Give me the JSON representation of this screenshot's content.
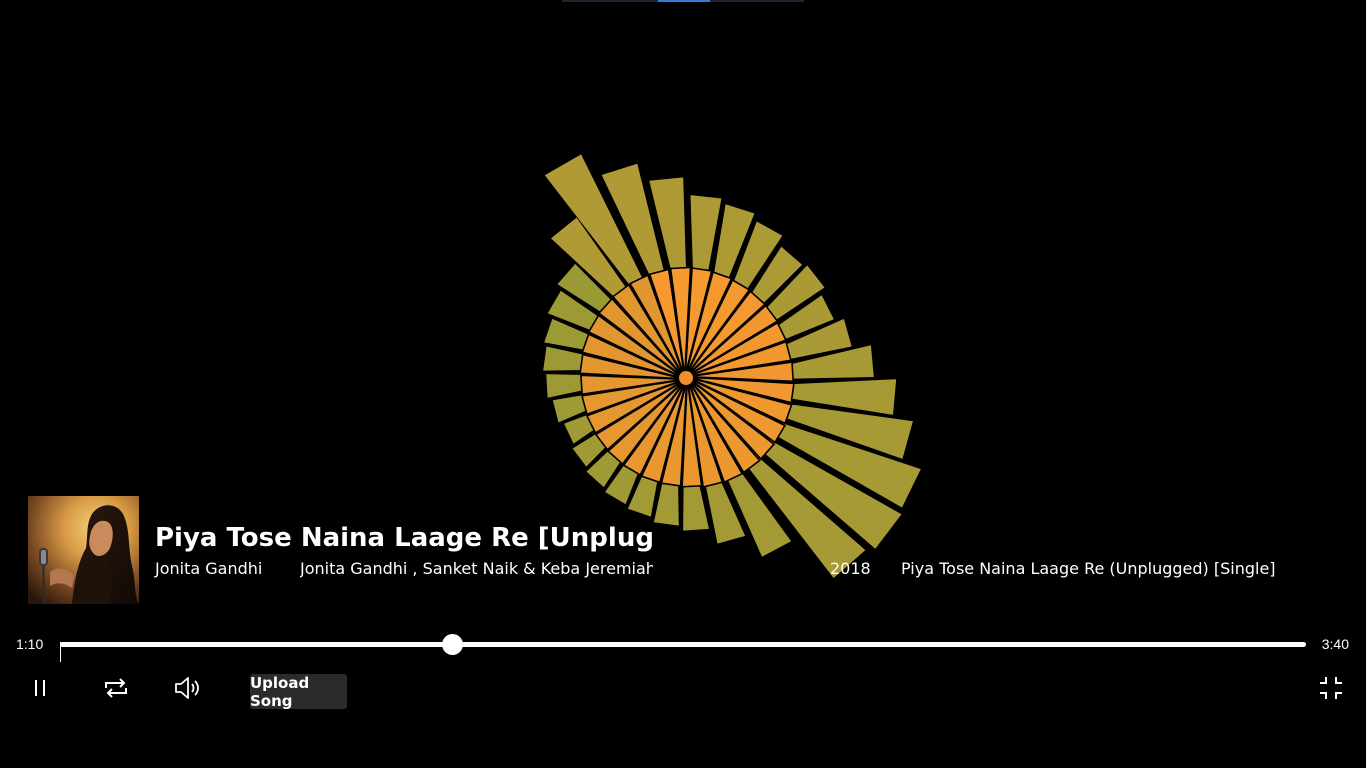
{
  "now_playing": {
    "title": "Piya Tose Naina Laage Re [Unplugged]",
    "artist": "Jonita Gandhi",
    "credits": "Jonita Gandhi , Sanket Naik & Keba Jeremiah",
    "year": "2018",
    "album": "Piya Tose Naina Laage Re (Unplugged) [Single]"
  },
  "playback": {
    "current_time": "1:10",
    "total_time": "3:40",
    "progress": 0.315,
    "state": "playing"
  },
  "controls": {
    "pause_icon": "pause-icon",
    "repeat_icon": "repeat-icon",
    "volume_icon": "volume-icon",
    "fullscreen_exit_icon": "exit-fullscreen-icon",
    "upload_label": "Upload Song"
  },
  "visualizer": {
    "type": "radial-spiral-bars",
    "bar_count": 32,
    "inner_colors": [
      "#f7992f",
      "#e09630"
    ],
    "outer_colors": [
      "#b09a35",
      "#9a9a35"
    ],
    "outer_levels": [
      0.62,
      0.95,
      0.78,
      0.66,
      0.55,
      0.52,
      0.48,
      0.42,
      0.44,
      0.4,
      0.46,
      0.58,
      0.72,
      0.85,
      0.98,
      1.0,
      0.96,
      0.62,
      0.46,
      0.36,
      0.33,
      0.3,
      0.28,
      0.26,
      0.24,
      0.22,
      0.25,
      0.28,
      0.3,
      0.32,
      0.36,
      0.4
    ],
    "inner_levels": [
      0.95,
      0.98,
      0.96,
      0.92,
      0.88,
      0.86,
      0.84,
      0.8,
      0.78,
      0.82,
      0.86,
      0.9,
      0.94,
      0.96,
      0.98,
      1.0,
      0.97,
      0.9,
      0.86,
      0.84,
      0.82,
      0.8,
      0.78,
      0.76,
      0.74,
      0.72,
      0.76,
      0.8,
      0.84,
      0.88,
      0.92,
      0.94
    ]
  }
}
